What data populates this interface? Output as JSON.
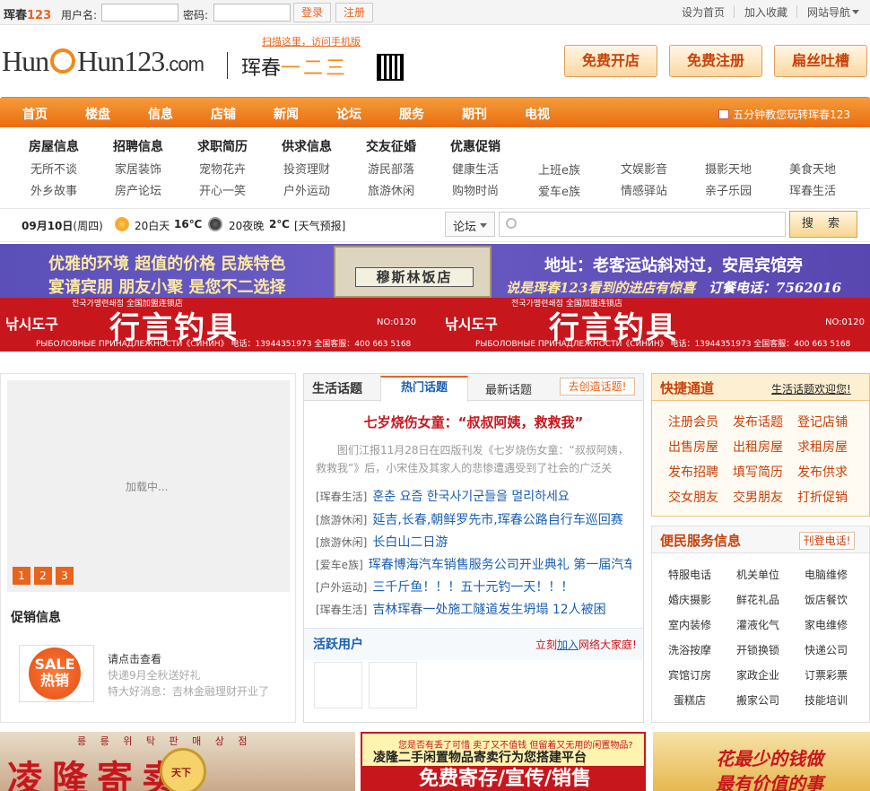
{
  "topbar": {
    "brand": "珲春",
    "brand_num": "123",
    "username_label": "用户名:",
    "password_label": "密码:",
    "login": "登录",
    "register": "注册",
    "links": [
      "设为首页",
      "加入收藏",
      "网站导航"
    ]
  },
  "header": {
    "logo_part1": "Hun",
    "logo_part2": "Hun",
    "logo_num": "123",
    "logo_com": ".com",
    "cn_name": "珲春",
    "cn_num": "一二三",
    "scan_text": "扫描这里，访问手机版",
    "buttons": [
      "免费开店",
      "免费注册",
      "扁丝吐槽"
    ]
  },
  "nav": {
    "items": [
      "首页",
      "楼盘",
      "信息",
      "店铺",
      "新闻",
      "论坛",
      "服务",
      "期刊",
      "电视"
    ],
    "promo": "五分钟教您玩转珲春123"
  },
  "categories": {
    "heads": [
      "房屋信息",
      "招聘信息",
      "求职简历",
      "供求信息",
      "交友征婚",
      "优惠促销"
    ],
    "row1": [
      "无所不谈",
      "家居装饰",
      "宠物花卉",
      "投资理财",
      "游民部落",
      "健康生活",
      "上班e族",
      "文娱影音",
      "摄影天地",
      "美食天地"
    ],
    "row2": [
      "外乡故事",
      "房产论坛",
      "开心一笑",
      "户外运动",
      "旅游休闲",
      "购物时尚",
      "爱车e族",
      "情感驿站",
      "亲子乐园",
      "珲春生活"
    ]
  },
  "weather": {
    "date": "09月10日",
    "weekday": "(周四)",
    "day_label": "20白天",
    "day_temp": "16℃",
    "night_label": "20夜晚",
    "night_temp": "2℃",
    "forecast": "[天气预报]"
  },
  "search": {
    "scope": "论坛",
    "button": "搜 索"
  },
  "banner1": {
    "left1": "优雅的环境 超值的价格 民族特色",
    "left2": "宴请宾朋 朋友小聚 是您不二选择",
    "hotel": "穆斯林饭店",
    "right1": "地址：老客运站斜对过，安居宾馆旁",
    "right2": "说是珲春123看到的进店有惊喜",
    "phone": "订餐电话：7562016"
  },
  "banner2": {
    "title": "行言钓具",
    "korean": "전국가맹련쇄점 全国加盟连锁店",
    "korean2": "낚시도구",
    "info": "РЫБОЛОВНЫЕ ПРИНАДЛЕЖНОСТИ《СИНИН》 电话：13944351973  全国客服：400 663 5168",
    "no": "NO:0120"
  },
  "slider": {
    "loading": "加载中...",
    "pages": [
      "1",
      "2",
      "3"
    ]
  },
  "promo": {
    "title": "促销信息",
    "sale1": "SALE",
    "sale2": "热销",
    "lines": [
      "请点击查看",
      "快递9月全秋送好礼",
      "特大好消息：吉林金融理财开业了"
    ]
  },
  "topics": {
    "section": "生活话题",
    "tabs": [
      "热门话题",
      "最新话题"
    ],
    "create": "去创造话题!",
    "headline": "七岁烧伤女童：“叔叔阿姨，救救我”",
    "summary": "图们江报11月28日在四版刊发《七岁烧伤女童：“叔叔阿姨，救救我”》后，小宋佳及其家人的悲惨遭遇受到了社会的广泛关",
    "items": [
      {
        "tag": "[珲春生活]",
        "title": "훈춘 요즘 한국사기군들을 멀리하세요"
      },
      {
        "tag": "[旅游休闲]",
        "title": "延吉,长春,朝鲜罗先市,珲春公路自行车巡回赛"
      },
      {
        "tag": "[旅游休闲]",
        "title": "长白山二日游"
      },
      {
        "tag": "[爱车e族]",
        "title": "珲春博海汽车销售服务公司开业典礼  第一届汽车"
      },
      {
        "tag": "[户外运动]",
        "title": "三千斤鱼！！！五十元钓一天！！！"
      },
      {
        "tag": "[珲春生活]",
        "title": "吉林珲春一处施工隧道发生坍塌  12人被困"
      }
    ],
    "active_title": "活跃用户",
    "join_pre": "立刻",
    "join_link": "加入",
    "join_post": "网络大家庭!"
  },
  "quick": {
    "title": "快捷通道",
    "note": "生活话题欢迎您!",
    "links": [
      "注册会员",
      "发布话题",
      "登记店铺",
      "出售房屋",
      "出租房屋",
      "求租房屋",
      "发布招聘",
      "填写简历",
      "发布供求",
      "交女朋友",
      "交男朋友",
      "打折促销"
    ]
  },
  "services": {
    "title": "便民服务信息",
    "phone_btn": "刊登电话!",
    "items": [
      "特服电话",
      "机关单位",
      "电脑维修",
      "婚庆摄影",
      "鲜花礼品",
      "饭店餐饮",
      "室内装修",
      "灌液化气",
      "家电维修",
      "洗浴按摩",
      "开锁换锁",
      "快递公司",
      "宾馆订房",
      "家政企业",
      "订票彩票",
      "蛋糕店",
      "搬家公司",
      "技能培训"
    ]
  },
  "bottom_ads": {
    "ad1_korean": "릉 릉 위 탁 판 매 상 점",
    "ad1_text": "凌隆寄卖",
    "ad1_coin": "天下",
    "ad2_top": "您是否有丢了可惜 卖了又不值钱 但留着又无用的闲置物品?",
    "ad2_mid": "凌隆二手闲置物品寄卖行为您搭建平台",
    "ad2_big": "免费寄存/宣传/销售",
    "ad3_a": "花最少的钱做",
    "ad3_b": "最有价值的事"
  },
  "colors": {
    "accent": "#e8641b",
    "link_blue": "#1a5fb4",
    "red": "#c8161d"
  }
}
